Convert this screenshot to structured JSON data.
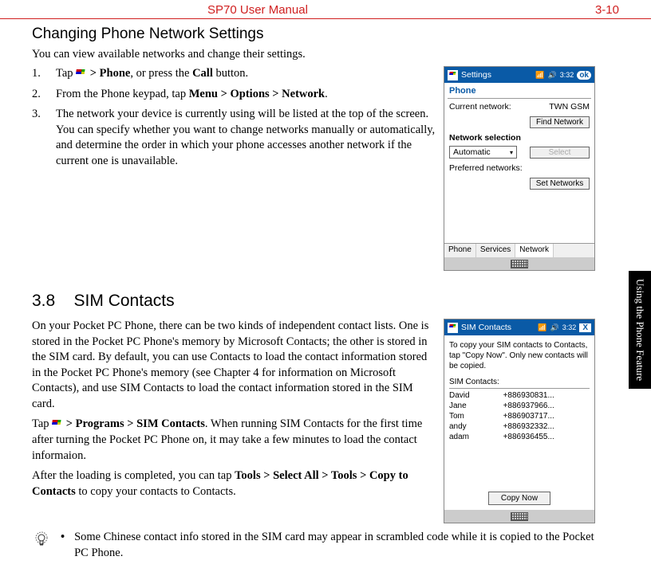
{
  "header": {
    "title": "SP70 User Manual",
    "page": "3-10"
  },
  "sidetab": "Using the Phone Feature",
  "section1": {
    "title": "Changing Phone Network Settings",
    "intro": "You can view available networks and change their settings.",
    "steps": {
      "s1a": "Tap ",
      "s1b": " > Phone",
      "s1c": ", or press the ",
      "s1d": "Call",
      "s1e": " button.",
      "s2a": "From the Phone keypad, tap ",
      "s2b": "Menu > Options > Network",
      "s2c": ".",
      "s3": "The network your device is currently using will be listed at the top of the screen. You can specify whether you want to change networks manually or automatically, and determine the order in which your phone accesses another network if the current one is unavailable."
    },
    "mock": {
      "title": "Settings",
      "time": "3:32",
      "ok": "ok",
      "header": "Phone",
      "current_label": "Current network:",
      "current_value": "TWN GSM",
      "find_btn": "Find Network",
      "netsel_label": "Network selection",
      "auto": "Automatic",
      "select_btn": "Select",
      "pref_label": "Preferred networks:",
      "setnet_btn": "Set Networks",
      "tabs": [
        "Phone",
        "Services",
        "Network"
      ]
    }
  },
  "section2": {
    "number": "3.8",
    "title": "SIM Contacts",
    "p1": "On your Pocket PC Phone, there can be two kinds of independent contact lists. One is stored in the Pocket PC Phone's memory by Microsoft Contacts; the other is stored in the SIM card. By default, you can use Contacts to load the contact information stored in the Pocket PC Phone's memory (see Chapter 4 for information on Microsoft Contacts), and use SIM Contacts to load the contact information stored in the SIM card.",
    "p2a": "Tap ",
    "p2b": " > Programs > SIM Contacts",
    "p2c": ". When running SIM Contacts for the first time after turning the Pocket PC Phone on, it may take a few minutes to load the contact informaion.",
    "p3a": "After the loading is completed, you can tap ",
    "p3b": "Tools > Select All > Tools > Copy to Contacts",
    "p3c": " to copy your contacts to Contacts.",
    "mock": {
      "title": "SIM Contacts",
      "time": "3:32",
      "msg": "To copy your SIM contacts to Contacts, tap \"Copy Now\". Only new contacts will be copied.",
      "listlabel": "SIM Contacts:",
      "contacts": [
        {
          "name": "David",
          "num": "+886930831..."
        },
        {
          "name": "Jane",
          "num": "+886937966..."
        },
        {
          "name": "Tom",
          "num": "+886903717..."
        },
        {
          "name": "andy",
          "num": "+886932332..."
        },
        {
          "name": "adam",
          "num": "+886936455..."
        }
      ],
      "copy_btn": "Copy Now"
    }
  },
  "note": {
    "bullet": "•",
    "text": "Some Chinese contact info stored in the SIM card may appear in scrambled code while it is copied to the Pocket PC Phone."
  }
}
